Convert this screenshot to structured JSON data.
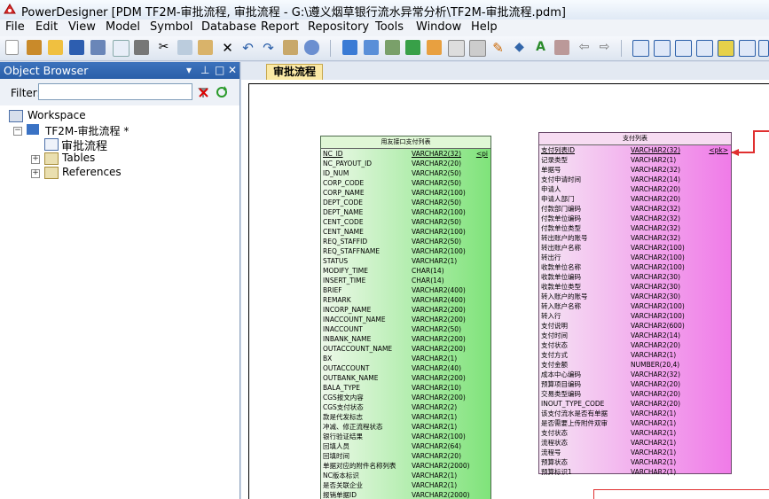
{
  "window": {
    "title": "PowerDesigner [PDM TF2M-审批流程, 审批流程 - G:\\遵义烟草银行流水异常分析\\TF2M-审批流程.pdm]"
  },
  "menu": [
    "File",
    "Edit",
    "View",
    "Model",
    "Symbol",
    "Database",
    "Report",
    "Repository",
    "Tools",
    "Window",
    "Help"
  ],
  "object_browser": {
    "title": "Object Browser",
    "filter_label": "Filter:",
    "filter_value": "",
    "tree": {
      "workspace": "Workspace",
      "model": "TF2M-审批流程 *",
      "diagram": "审批流程",
      "tables": "Tables",
      "references": "References"
    }
  },
  "tab": {
    "label": "审批流程"
  },
  "entity1": {
    "title": "用友接口支付列表",
    "columns": [
      {
        "name": "NC_ID",
        "type": "VARCHAR2(32)",
        "key": "<pi"
      },
      {
        "name": "NC_PAYOUT_ID",
        "type": "VARCHAR2(20)",
        "key": ""
      },
      {
        "name": "ID_NUM",
        "type": "VARCHAR2(50)",
        "key": ""
      },
      {
        "name": "CORP_CODE",
        "type": "VARCHAR2(50)",
        "key": ""
      },
      {
        "name": "CORP_NAME",
        "type": "VARCHAR2(100)",
        "key": ""
      },
      {
        "name": "DEPT_CODE",
        "type": "VARCHAR2(50)",
        "key": ""
      },
      {
        "name": "DEPT_NAME",
        "type": "VARCHAR2(100)",
        "key": ""
      },
      {
        "name": "CENT_CODE",
        "type": "VARCHAR2(50)",
        "key": ""
      },
      {
        "name": "CENT_NAME",
        "type": "VARCHAR2(100)",
        "key": ""
      },
      {
        "name": "REQ_STAFFID",
        "type": "VARCHAR2(50)",
        "key": ""
      },
      {
        "name": "REQ_STAFFNAME",
        "type": "VARCHAR2(100)",
        "key": ""
      },
      {
        "name": "STATUS",
        "type": "VARCHAR2(1)",
        "key": ""
      },
      {
        "name": "MODIFY_TIME",
        "type": "CHAR(14)",
        "key": ""
      },
      {
        "name": "INSERT_TIME",
        "type": "CHAR(14)",
        "key": ""
      },
      {
        "name": "BRIEF",
        "type": "VARCHAR2(400)",
        "key": ""
      },
      {
        "name": "REMARK",
        "type": "VARCHAR2(400)",
        "key": ""
      },
      {
        "name": "INCORP_NAME",
        "type": "VARCHAR2(200)",
        "key": ""
      },
      {
        "name": "INACCOUNT_NAME",
        "type": "VARCHAR2(200)",
        "key": ""
      },
      {
        "name": "INACCOUNT",
        "type": "VARCHAR2(50)",
        "key": ""
      },
      {
        "name": "INBANK_NAME",
        "type": "VARCHAR2(200)",
        "key": ""
      },
      {
        "name": "OUTACCOUNT_NAME",
        "type": "VARCHAR2(200)",
        "key": ""
      },
      {
        "name": "BX",
        "type": "VARCHAR2(1)",
        "key": ""
      },
      {
        "name": "OUTACCOUNT",
        "type": "VARCHAR2(40)",
        "key": ""
      },
      {
        "name": "OUTBANK_NAME",
        "type": "VARCHAR2(200)",
        "key": ""
      },
      {
        "name": "BALA_TYPE",
        "type": "VARCHAR2(10)",
        "key": ""
      },
      {
        "name": "CGS报文内容",
        "type": "VARCHAR2(200)",
        "key": ""
      },
      {
        "name": "CGS支付状态",
        "type": "VARCHAR2(2)",
        "key": ""
      },
      {
        "name": "款是代发标志",
        "type": "VARCHAR2(1)",
        "key": ""
      },
      {
        "name": "冲减、修正流程状态",
        "type": "VARCHAR2(1)",
        "key": ""
      },
      {
        "name": "银行验证结果",
        "type": "VARCHAR2(100)",
        "key": ""
      },
      {
        "name": "回填人员",
        "type": "VARCHAR2(64)",
        "key": ""
      },
      {
        "name": "回填时间",
        "type": "VARCHAR2(20)",
        "key": ""
      },
      {
        "name": "单据对应的附件名称列表",
        "type": "VARCHAR2(2000)",
        "key": ""
      },
      {
        "name": "NC版本标识",
        "type": "VARCHAR2(1)",
        "key": ""
      },
      {
        "name": "是否关联企业",
        "type": "VARCHAR2(1)",
        "key": ""
      },
      {
        "name": "报销单据ID",
        "type": "VARCHAR2(2000)",
        "key": ""
      }
    ]
  },
  "entity2": {
    "title": "支付列表",
    "columns": [
      {
        "name": "支付列表ID",
        "type": "VARCHAR2(32)",
        "key": "<pk>"
      },
      {
        "name": "记录类型",
        "type": "VARCHAR2(1)",
        "key": ""
      },
      {
        "name": "单据号",
        "type": "VARCHAR2(32)",
        "key": ""
      },
      {
        "name": "支付申请时间",
        "type": "VARCHAR2(14)",
        "key": ""
      },
      {
        "name": "申请人",
        "type": "VARCHAR2(20)",
        "key": ""
      },
      {
        "name": "申请人部门",
        "type": "VARCHAR2(20)",
        "key": ""
      },
      {
        "name": "付款部门编码",
        "type": "VARCHAR2(32)",
        "key": ""
      },
      {
        "name": "付款单位编码",
        "type": "VARCHAR2(32)",
        "key": ""
      },
      {
        "name": "付款单位类型",
        "type": "VARCHAR2(32)",
        "key": ""
      },
      {
        "name": "转出账户的账号",
        "type": "VARCHAR2(32)",
        "key": ""
      },
      {
        "name": "转出账户名称",
        "type": "VARCHAR2(100)",
        "key": ""
      },
      {
        "name": "转出行",
        "type": "VARCHAR2(100)",
        "key": ""
      },
      {
        "name": "收款单位名称",
        "type": "VARCHAR2(100)",
        "key": ""
      },
      {
        "name": "收款单位编码",
        "type": "VARCHAR2(30)",
        "key": ""
      },
      {
        "name": "收款单位类型",
        "type": "VARCHAR2(30)",
        "key": ""
      },
      {
        "name": "转入账户的账号",
        "type": "VARCHAR2(30)",
        "key": ""
      },
      {
        "name": "转入账户名称",
        "type": "VARCHAR2(100)",
        "key": ""
      },
      {
        "name": "转入行",
        "type": "VARCHAR2(100)",
        "key": ""
      },
      {
        "name": "支付说明",
        "type": "VARCHAR2(600)",
        "key": ""
      },
      {
        "name": "支付时间",
        "type": "VARCHAR2(14)",
        "key": ""
      },
      {
        "name": "支付状态",
        "type": "VARCHAR2(20)",
        "key": ""
      },
      {
        "name": "支付方式",
        "type": "VARCHAR2(1)",
        "key": ""
      },
      {
        "name": "支付金额",
        "type": "NUMBER(20,4)",
        "key": ""
      },
      {
        "name": "成本中心编码",
        "type": "VARCHAR2(32)",
        "key": ""
      },
      {
        "name": "预算项目编码",
        "type": "VARCHAR2(20)",
        "key": ""
      },
      {
        "name": "交易类型编码",
        "type": "VARCHAR2(20)",
        "key": ""
      },
      {
        "name": "INOUT_TYPE_CODE",
        "type": "VARCHAR2(20)",
        "key": ""
      },
      {
        "name": "该支付流水是否有单据",
        "type": "VARCHAR2(1)",
        "key": ""
      },
      {
        "name": "是否需要上传附件双审",
        "type": "VARCHAR2(1)",
        "key": ""
      },
      {
        "name": "支付状态",
        "type": "VARCHAR2(1)",
        "key": ""
      },
      {
        "name": "流程状态",
        "type": "VARCHAR2(1)",
        "key": ""
      },
      {
        "name": "流程号",
        "type": "VARCHAR2(1)",
        "key": ""
      },
      {
        "name": "预算状态",
        "type": "VARCHAR2(1)",
        "key": ""
      },
      {
        "name": "预算标识1",
        "type": "VARCHAR2(1)",
        "key": ""
      }
    ]
  }
}
